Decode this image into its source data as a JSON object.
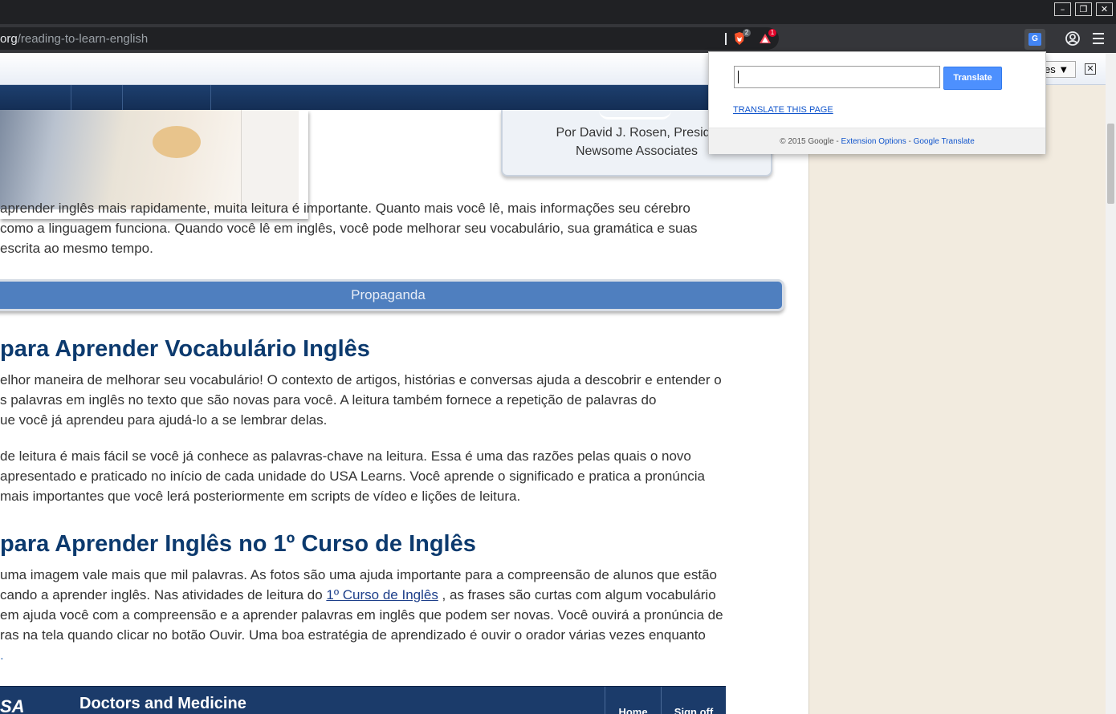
{
  "browser": {
    "url_host": "org",
    "url_path": "/reading-to-learn-english",
    "window_buttons": {
      "minimize": "–",
      "restore": "❐",
      "close": "✕"
    },
    "brave_badge": "2",
    "rewards_badge": "1",
    "colors": {
      "titlebar": "#202124",
      "toolbar": "#35363a",
      "accent": "#4285f4"
    }
  },
  "translate_bar": {
    "language_select": "es ▼",
    "close_label": "✕"
  },
  "author": {
    "line1": "Por David J. Rosen, Preside",
    "line2": "Newsome Associates"
  },
  "intro": {
    "lines": [
      "aprender inglês mais rapidamente, muita leitura é importante. Quanto mais você lê, mais informações seu cérebro",
      "como a linguagem funciona. Quando você lê em inglês, você pode melhorar seu vocabulário, sua gramática e suas",
      " escrita ao mesmo tempo."
    ]
  },
  "ad_label": "Propaganda",
  "section1": {
    "heading": "para Aprender Vocabulário Inglês",
    "para1": [
      "elhor maneira de melhorar seu vocabulário! O contexto de artigos, histórias e conversas ajuda a descobrir e entender o",
      "s palavras em inglês no texto que são novas para você. A leitura também fornece a repetição de palavras do",
      "ue você já aprendeu para ajudá-lo a se lembrar delas."
    ],
    "para2": [
      " de leitura é mais fácil se você já conhece as palavras-chave na leitura. Essa é uma das razões pelas quais o novo",
      "apresentado e praticado no início de cada unidade do USA Learns. Você aprende o significado e pratica a pronúncia",
      "mais importantes que você lerá posteriormente em scripts de vídeo e lições de leitura."
    ]
  },
  "section2": {
    "heading": "para Aprender Inglês no 1º Curso de Inglês",
    "line1": "uma imagem vale mais que mil palavras. As fotos são uma ajuda importante para a compreensão de alunos que estão",
    "line2_before": "cando a aprender inglês. Nas atividades de leitura do ",
    "line2_link": "1º Curso de Inglês",
    "line2_after": " , as frases são curtas com algum vocabulário",
    "line3": "em ajuda você com a compreensão e a aprender palavras em inglês que podem ser novas. Você ouvirá a pronúncia de",
    "line4": "ras na tela quando clicar no botão Ouvir. Uma boa estratégia de aprendizado é ouvir o orador várias vezes enquanto",
    "line5": "."
  },
  "video": {
    "logo": "SA",
    "title": "Doctors and Medicine",
    "home": "Home",
    "signoff": "Sign off"
  },
  "translate_popup": {
    "input_value": "",
    "button": "Translate",
    "translate_page_link": "TRANSLATE THIS PAGE",
    "footer_copyright": "© 2015 Google - ",
    "footer_options": "Extension Options",
    "footer_sep": " - ",
    "footer_gt": "Google Translate"
  }
}
